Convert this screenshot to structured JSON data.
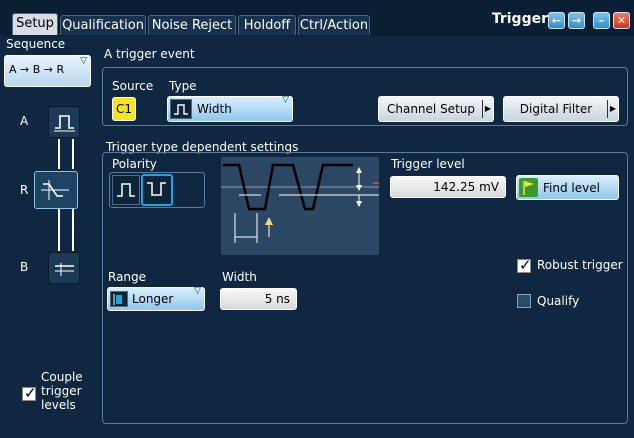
{
  "tabs": [
    "Setup",
    "Qualification",
    "Noise Reject",
    "Holdoff",
    "Ctrl/Action"
  ],
  "active_tab": "Setup",
  "window": {
    "title": "Trigger"
  },
  "sidebar": {
    "sequence_label": "Sequence",
    "sequence_value": "A → B → R",
    "stages": [
      "A",
      "R",
      "B"
    ],
    "couple_label": "Couple\ntrigger\nlevels",
    "couple_checked": true
  },
  "event": {
    "title": "A trigger event",
    "source_label": "Source",
    "source_value": "C1",
    "type_label": "Type",
    "type_value": "Width",
    "channel_setup": "Channel Setup",
    "digital_filter": "Digital Filter"
  },
  "settings": {
    "title": "Trigger type dependent settings",
    "polarity_label": "Polarity",
    "trigger_level_label": "Trigger level",
    "trigger_level_value": "142.25 mV",
    "find_level": "Find level",
    "range_label": "Range",
    "range_value": "Longer",
    "width_label": "Width",
    "width_value": "5 ns",
    "robust_trigger": "Robust trigger",
    "robust_checked": true,
    "qualify": "Qualify",
    "qualify_checked": false
  },
  "colors": {
    "background": "#0f2740",
    "source_badge": "#f5e51f",
    "selected_polarity": "#17a7e8",
    "find_level_icon": "#3a9a2a"
  },
  "icons": [
    "back-icon",
    "forward-icon",
    "minimize-icon",
    "close-icon",
    "pulse-width-icon",
    "flag-icon",
    "checkmark-icon"
  ]
}
